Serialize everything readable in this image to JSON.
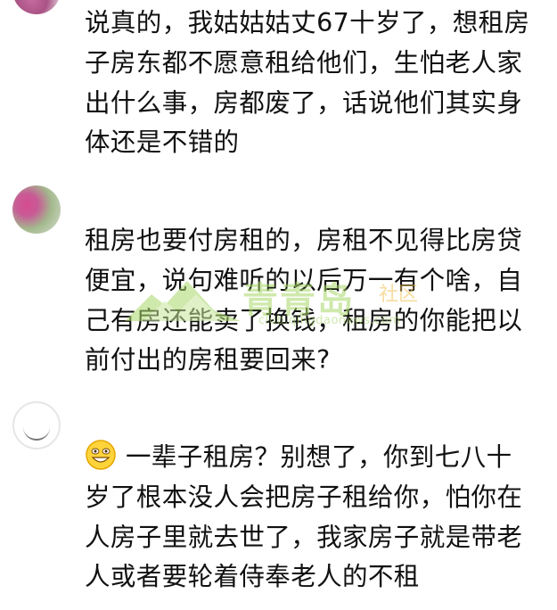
{
  "comments": [
    {
      "lines": [
        "说真的，我姑姑姑丈67十岁了，想租房",
        "子房东都不愿意租给他们，生怕老人家",
        "出什么事，房都废了，话说他们其实身",
        "体还是不错的"
      ]
    },
    {
      "lines": [
        "租房也要付房租的，房租不见得比房贷",
        "便宜，说句难听的以后万一有个啥，自",
        "己有房还能卖了换钱，租房的你能把以",
        "前付出的房租要回来?"
      ]
    },
    {
      "emoji": "grin-emoji",
      "lines": [
        "一辈子租房？别想了，你到七八十",
        "岁了根本没人会把房子租给你，怕你在",
        "人房子里就去世了，我家房子就是带老",
        "人或者要轮着侍奉老人的不租"
      ]
    }
  ],
  "watermark": {
    "title": "青青岛",
    "badge": "社区",
    "url": "club.qingdaonews.com"
  }
}
